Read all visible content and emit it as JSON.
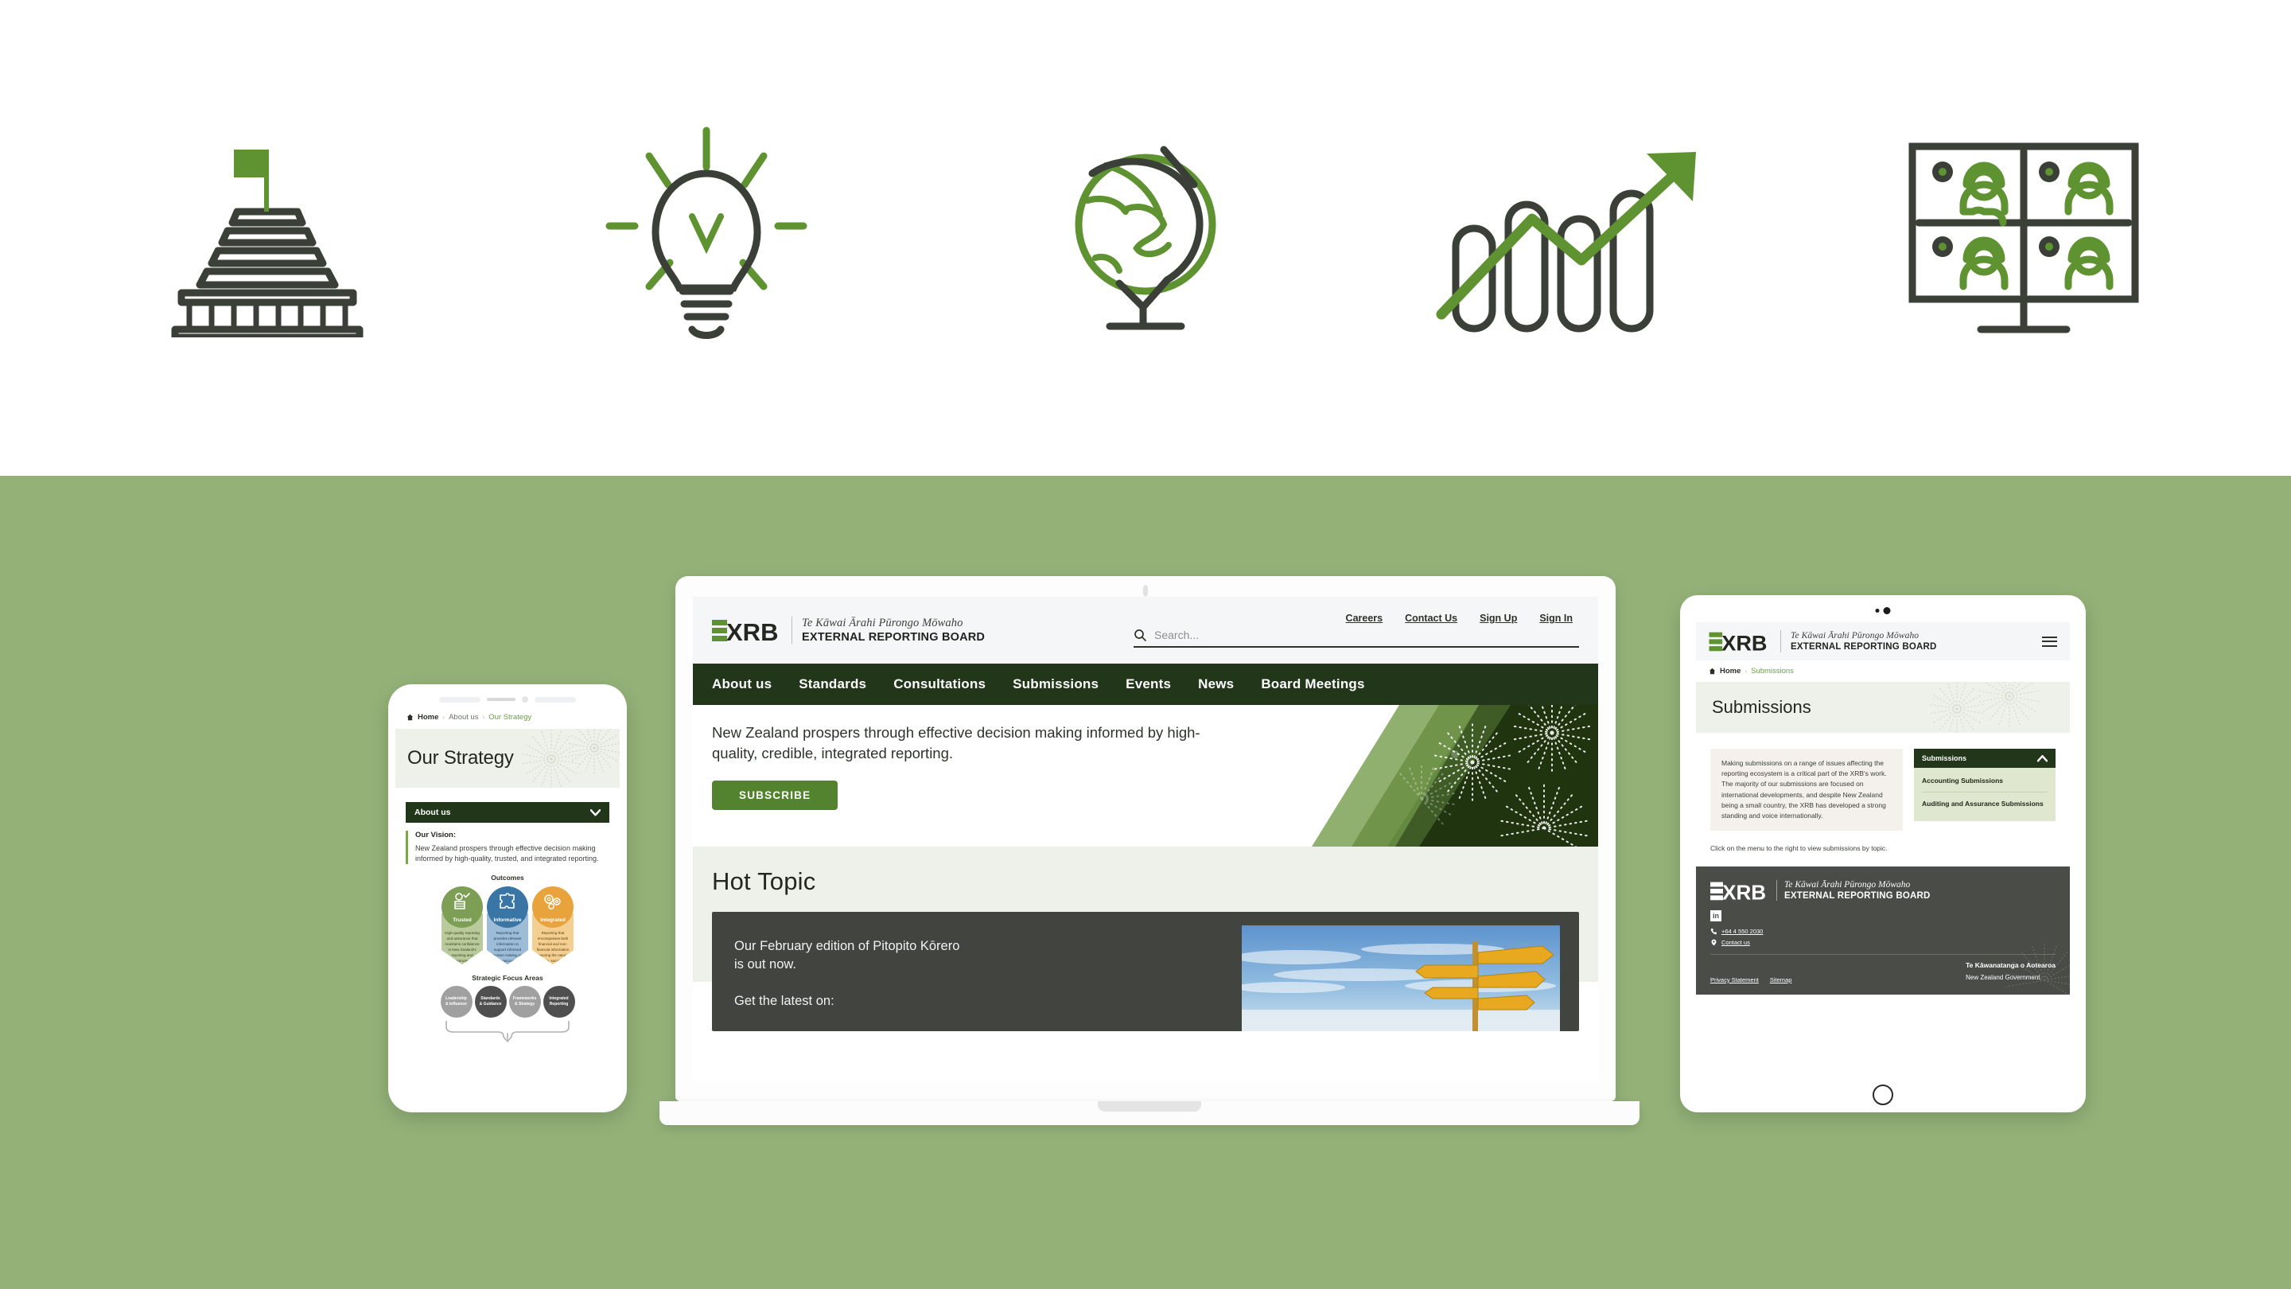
{
  "brand": {
    "accent_green": "#6ca03c",
    "dark_green": "#22361a",
    "stage_green": "#94b278",
    "charcoal": "#3a3f37",
    "button_green": "#53832f"
  },
  "top_icons": [
    {
      "name": "parliament-building-icon",
      "label": "Parliament building with flag"
    },
    {
      "name": "lightbulb-icon",
      "label": "Lightbulb with rays"
    },
    {
      "name": "globe-icon",
      "label": "Globe on stand"
    },
    {
      "name": "growth-chart-icon",
      "label": "Bar chart with rising arrow"
    },
    {
      "name": "video-conference-icon",
      "label": "Video conference grid of four people"
    }
  ],
  "logo": {
    "mark": "XRB",
    "tagline_mi": "Te Kāwai Ārahi Pūrongo Mōwaho",
    "tagline_en": "EXTERNAL REPORTING BOARD"
  },
  "laptop": {
    "top_links": [
      "Careers",
      "Contact Us",
      "Sign Up",
      "Sign In"
    ],
    "search": {
      "placeholder": "Search...",
      "value": "",
      "icon": "search-icon"
    },
    "nav": [
      "About us",
      "Standards",
      "Consultations",
      "Submissions",
      "Events",
      "News",
      "Board Meetings"
    ],
    "hero": {
      "statement": "New Zealand prospers through effective decision making informed by high-quality, credible, integrated reporting.",
      "cta": "SUBSCRIBE"
    },
    "hot_topic": {
      "heading": "Hot Topic",
      "line1": "Our February edition of Pitopito Kōrero",
      "line2": "is out now.",
      "line3": "Get the latest on:",
      "image_alt": "Signpost against blue sky"
    }
  },
  "phone": {
    "breadcrumb": {
      "home": "Home",
      "middle": "About us",
      "current": "Our Strategy",
      "home_icon": "home-icon",
      "separator_icon": "chevron-right-icon"
    },
    "page_title": "Our Strategy",
    "accordion": {
      "label": "About us",
      "icon": "chevron-down-icon"
    },
    "vision": {
      "heading": "Our Vision:",
      "body": "New Zealand prospers through effective decision making informed by high-quality, trusted, and integrated reporting."
    },
    "outcomes_label": "Outcomes",
    "outcomes": [
      {
        "title": "Trusted",
        "icon": "person-check-icon",
        "color": "#7d9e55",
        "body_color": "#b9cb9b",
        "body": "High-quality reporting and assurance that maintains confidence in New Zealand's reporting and promotes transparency and accountability across all sectors of the economy."
      },
      {
        "title": "Informative",
        "icon": "puzzle-icon",
        "color": "#3a76a5",
        "body_color": "#9cbcd8",
        "body": "Reporting that provides relevant information to support informed decision making and better outcomes for New Zealand."
      },
      {
        "title": "Integrated",
        "icon": "gears-icon",
        "color": "#e8a33d",
        "body_color": "#f4cf92",
        "body": "Reporting that encompasses both financial and non-financial information spanning the natural, human, social, and financial capitals that support intergenerational wellbeing."
      }
    ],
    "focus_label": "Strategic Focus Areas",
    "focus_areas": [
      {
        "line1": "Leadership",
        "line2": "& Influence",
        "color": "#a0a0a0"
      },
      {
        "line1": "Standards",
        "line2": "& Guidance",
        "color": "#4f4f4f"
      },
      {
        "line1": "Frameworks",
        "line2": "& Strategy",
        "color": "#a0a0a0"
      },
      {
        "line1": "Integrated",
        "line2": "Reporting",
        "color": "#4f4f4f"
      }
    ]
  },
  "tablet": {
    "menu_icon": "hamburger-menu-icon",
    "breadcrumb": {
      "home": "Home",
      "current": "Submissions",
      "home_icon": "home-icon",
      "separator_icon": "chevron-right-icon"
    },
    "page_title": "Submissions",
    "intro": "Making submissions on a range of issues affecting the reporting ecosystem is a critical part of the XRB's work. The majority of our submissions are focused on international developments, and despite New Zealand being a small country, the XRB has developed a strong standing and voice internationally.",
    "side_menu": {
      "title": "Submissions",
      "toggle_icon": "chevron-up-icon",
      "items": [
        "Accounting Submissions",
        "Auditing and Assurance Submissions"
      ]
    },
    "note": "Click on the menu to the right to view submissions by topic.",
    "footer": {
      "linkedin": "in",
      "phone": "+64 4 550 2030",
      "phone_icon": "phone-icon",
      "contact": "Contact us",
      "contact_icon": "map-pin-icon",
      "links": [
        "Privacy Statement",
        "Sitemap"
      ],
      "govt_mi": "Te Kāwanatanga o Aotearoa",
      "govt_en": "New Zealand Government"
    }
  }
}
